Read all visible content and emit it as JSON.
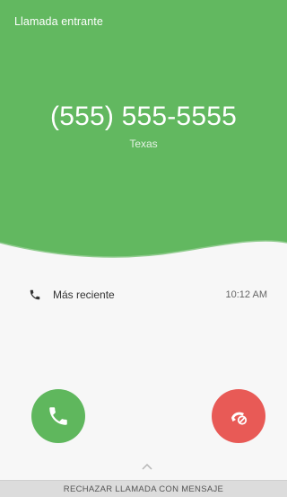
{
  "header": {
    "status_label": "Llamada entrante",
    "caller_number": "(555) 555-5555",
    "caller_location": "Texas"
  },
  "recent": {
    "icon": "phone-icon",
    "label": "Más reciente",
    "time": "10:12 AM"
  },
  "actions": {
    "answer_icon": "phone-answer-icon",
    "decline_icon": "phone-decline-icon",
    "reject_with_message_label": "RECHAZAR LLAMADA CON MENSAJE",
    "chevron_icon": "chevron-up-icon"
  },
  "colors": {
    "header_green": "#62b860",
    "answer_green": "#5fb75d",
    "decline_red": "#e85a56"
  }
}
